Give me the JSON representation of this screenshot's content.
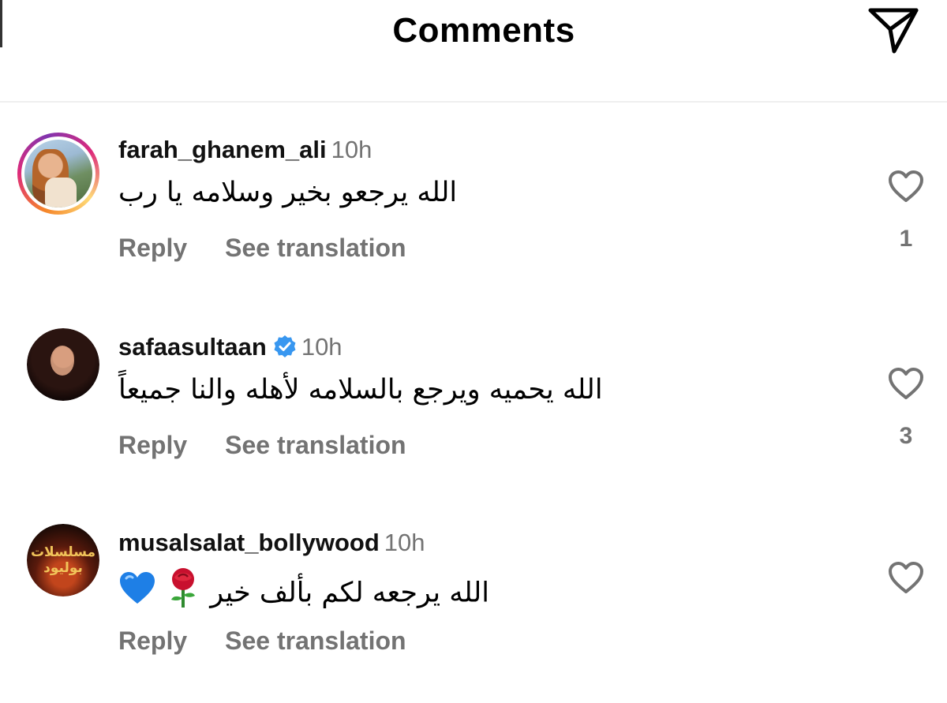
{
  "header": {
    "title": "Comments",
    "send_icon": "paper-plane-icon"
  },
  "actions": {
    "reply_label": "Reply",
    "translate_label": "See translation"
  },
  "comments": [
    {
      "username": "farah_ghanem_ali",
      "time": "10h",
      "verified": false,
      "has_story_ring": true,
      "text": "الله يرجعو بخير وسلامه يا رب",
      "likes": "1"
    },
    {
      "username": "safaasultaan",
      "time": "10h",
      "verified": true,
      "has_story_ring": false,
      "text": "الله يحميه ويرجع بالسلامه لأهله والنا جميعاً",
      "likes": "3"
    },
    {
      "username": "musalsalat_bollywood",
      "time": "10h",
      "verified": false,
      "has_story_ring": false,
      "text": "الله يرجعه لكم بألف خير",
      "text_emojis": [
        "rose",
        "blue-heart"
      ],
      "avatar_logo_line1": "مسلسلات",
      "avatar_logo_line2": "بوليود",
      "likes": ""
    }
  ],
  "colors": {
    "secondary_text": "#737373",
    "verified_blue": "#3897f0",
    "divider": "#efefef"
  }
}
